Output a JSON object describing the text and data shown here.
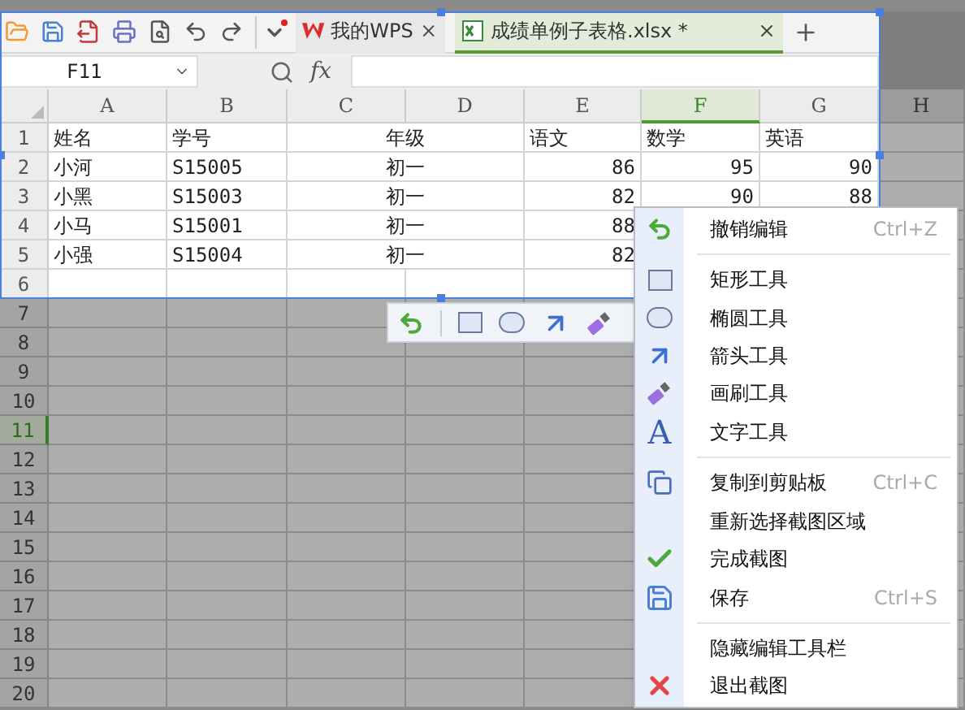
{
  "quick_toolbar": {
    "menu_badge": true
  },
  "tabs": [
    {
      "label": "我的WPS",
      "kind": "home",
      "selected": false
    },
    {
      "label": "成绩单例子表格.xlsx *",
      "kind": "sheet",
      "selected": true
    }
  ],
  "formula_bar": {
    "name_box": "F11",
    "fx": "fx"
  },
  "columns": [
    {
      "label": "A",
      "selected": false,
      "in_capture": true
    },
    {
      "label": "B",
      "selected": false,
      "in_capture": true
    },
    {
      "label": "C",
      "selected": false,
      "in_capture": true
    },
    {
      "label": "D",
      "selected": false,
      "in_capture": true
    },
    {
      "label": "E",
      "selected": false,
      "in_capture": true
    },
    {
      "label": "F",
      "selected": true,
      "in_capture": true
    },
    {
      "label": "G",
      "selected": false,
      "in_capture": true
    },
    {
      "label": "H",
      "selected": false,
      "in_capture": false
    }
  ],
  "rows": [
    {
      "number": "1",
      "selected": false,
      "in_capture": true,
      "cells": [
        {
          "text": "姓名",
          "kind": "text"
        },
        {
          "text": "学号",
          "kind": "text"
        },
        {
          "text": "年级",
          "kind": "merged"
        },
        {
          "text": "语文",
          "kind": "text"
        },
        {
          "text": "数学",
          "kind": "text"
        },
        {
          "text": "英语",
          "kind": "text"
        }
      ]
    },
    {
      "number": "2",
      "selected": false,
      "in_capture": true,
      "cells": [
        {
          "text": "小河",
          "kind": "text"
        },
        {
          "text": "S15005",
          "kind": "text"
        },
        {
          "text": "初一",
          "kind": "merged"
        },
        {
          "text": "86",
          "kind": "number"
        },
        {
          "text": "95",
          "kind": "number"
        },
        {
          "text": "90",
          "kind": "number"
        }
      ]
    },
    {
      "number": "3",
      "selected": false,
      "in_capture": true,
      "cells": [
        {
          "text": "小黑",
          "kind": "text"
        },
        {
          "text": "S15003",
          "kind": "text"
        },
        {
          "text": "初一",
          "kind": "merged"
        },
        {
          "text": "82",
          "kind": "number"
        },
        {
          "text": "90",
          "kind": "number"
        },
        {
          "text": "88",
          "kind": "number"
        }
      ]
    },
    {
      "number": "4",
      "selected": false,
      "in_capture": true,
      "cells": [
        {
          "text": "小马",
          "kind": "text"
        },
        {
          "text": "S15001",
          "kind": "text"
        },
        {
          "text": "初一",
          "kind": "merged"
        },
        {
          "text": "88",
          "kind": "number"
        }
      ]
    },
    {
      "number": "5",
      "selected": false,
      "in_capture": true,
      "cells": [
        {
          "text": "小强",
          "kind": "text"
        },
        {
          "text": "S15004",
          "kind": "text"
        },
        {
          "text": "初一",
          "kind": "merged"
        },
        {
          "text": "82",
          "kind": "number"
        }
      ]
    },
    {
      "number": "6",
      "selected": false,
      "in_capture": true,
      "cells": []
    },
    {
      "number": "7",
      "selected": false,
      "in_capture": false,
      "cells": []
    },
    {
      "number": "8",
      "selected": false,
      "in_capture": false,
      "cells": []
    },
    {
      "number": "9",
      "selected": false,
      "in_capture": false,
      "cells": []
    },
    {
      "number": "10",
      "selected": false,
      "in_capture": false,
      "cells": []
    },
    {
      "number": "11",
      "selected": true,
      "in_capture": false,
      "cells": []
    },
    {
      "number": "12",
      "selected": false,
      "in_capture": false,
      "cells": []
    },
    {
      "number": "13",
      "selected": false,
      "in_capture": false,
      "cells": []
    },
    {
      "number": "14",
      "selected": false,
      "in_capture": false,
      "cells": []
    },
    {
      "number": "15",
      "selected": false,
      "in_capture": false,
      "cells": []
    },
    {
      "number": "16",
      "selected": false,
      "in_capture": false,
      "cells": []
    },
    {
      "number": "17",
      "selected": false,
      "in_capture": false,
      "cells": []
    },
    {
      "number": "18",
      "selected": false,
      "in_capture": false,
      "cells": []
    },
    {
      "number": "19",
      "selected": false,
      "in_capture": false,
      "cells": []
    },
    {
      "number": "20",
      "selected": false,
      "in_capture": false,
      "cells": []
    }
  ],
  "context_menu": {
    "items": [
      {
        "kind": "undo",
        "label": "撤销编辑",
        "shortcut": "Ctrl+Z"
      },
      {
        "kind": "separator"
      },
      {
        "kind": "rectangle",
        "label": "矩形工具"
      },
      {
        "kind": "ellipse",
        "label": "椭圆工具"
      },
      {
        "kind": "arrow",
        "label": "箭头工具"
      },
      {
        "kind": "brush",
        "label": "画刷工具"
      },
      {
        "kind": "text",
        "icon_char": "A",
        "label": "文字工具"
      },
      {
        "kind": "separator"
      },
      {
        "kind": "copy",
        "label": "复制到剪贴板",
        "shortcut": "Ctrl+C"
      },
      {
        "kind": "plain",
        "label": "重新选择截图区域"
      },
      {
        "kind": "check",
        "label": "完成截图"
      },
      {
        "kind": "save",
        "label": "保存",
        "shortcut": "Ctrl+S"
      },
      {
        "kind": "separator"
      },
      {
        "kind": "plain",
        "label": "隐藏编辑工具栏"
      },
      {
        "kind": "exit",
        "label": "退出截图"
      }
    ]
  }
}
